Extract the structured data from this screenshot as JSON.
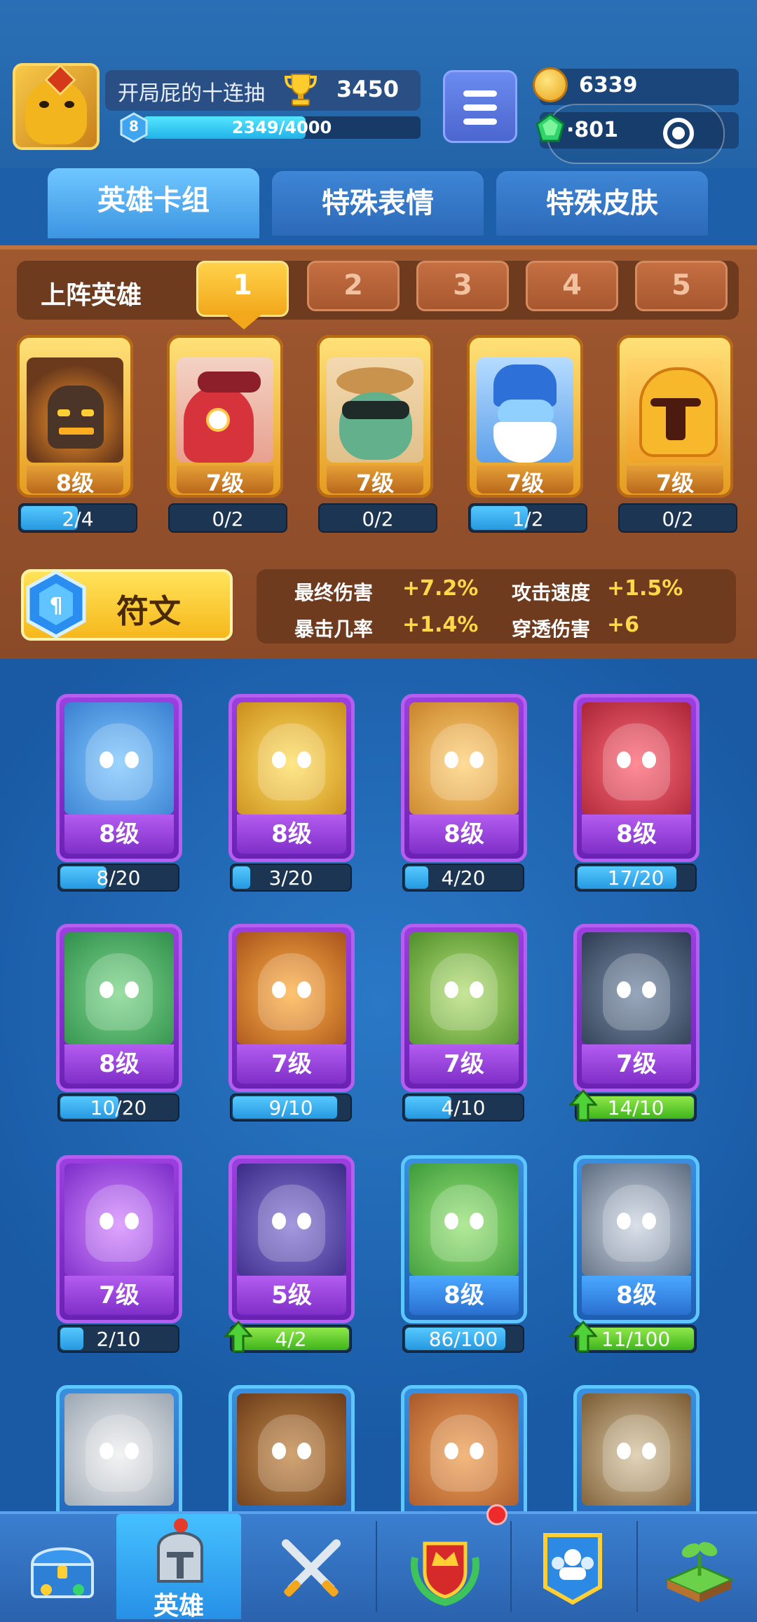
{
  "player": {
    "name": "开局屁的十连抽",
    "trophies": "3450",
    "level": "8",
    "xp_text": "2349/4000",
    "xp_fraction": 0.587
  },
  "resources": {
    "coins": "6339",
    "gems": "·801"
  },
  "tabs": [
    {
      "label": "英雄卡组",
      "active": true
    },
    {
      "label": "特殊表情",
      "active": false
    },
    {
      "label": "特殊皮肤",
      "active": false
    }
  ],
  "lineup": {
    "label": "上阵英雄",
    "slots": [
      "1",
      "2",
      "3",
      "4",
      "5"
    ],
    "active_slot": "1",
    "heroes": [
      {
        "level": "8级",
        "progress": "2/4",
        "fraction": 0.5
      },
      {
        "level": "7级",
        "progress": "0/2",
        "fraction": 0
      },
      {
        "level": "7级",
        "progress": "0/2",
        "fraction": 0
      },
      {
        "level": "7级",
        "progress": "1/2",
        "fraction": 0.5
      },
      {
        "level": "7级",
        "progress": "0/2",
        "fraction": 0
      }
    ]
  },
  "rune": {
    "label": "符文",
    "stats": [
      {
        "name": "最终伤害",
        "value": "+7.2%"
      },
      {
        "name": "攻击速度",
        "value": "+1.5%"
      },
      {
        "name": "暴击几率",
        "value": "+1.4%"
      },
      {
        "name": "穿透伤害",
        "value": "+6"
      }
    ]
  },
  "collection": [
    {
      "level": "8级",
      "progress": "8/20",
      "fraction": 0.4,
      "upgradable": false,
      "rarity": "purple"
    },
    {
      "level": "8级",
      "progress": "3/20",
      "fraction": 0.15,
      "upgradable": false,
      "rarity": "purple"
    },
    {
      "level": "8级",
      "progress": "4/20",
      "fraction": 0.2,
      "upgradable": false,
      "rarity": "purple"
    },
    {
      "level": "8级",
      "progress": "17/20",
      "fraction": 0.85,
      "upgradable": false,
      "rarity": "purple"
    },
    {
      "level": "8级",
      "progress": "10/20",
      "fraction": 0.5,
      "upgradable": false,
      "rarity": "purple"
    },
    {
      "level": "7级",
      "progress": "9/10",
      "fraction": 0.9,
      "upgradable": false,
      "rarity": "purple"
    },
    {
      "level": "7级",
      "progress": "4/10",
      "fraction": 0.4,
      "upgradable": false,
      "rarity": "purple"
    },
    {
      "level": "7级",
      "progress": "14/10",
      "fraction": 1,
      "upgradable": true,
      "rarity": "purple"
    },
    {
      "level": "7级",
      "progress": "2/10",
      "fraction": 0.2,
      "upgradable": false,
      "rarity": "purple"
    },
    {
      "level": "5级",
      "progress": "4/2",
      "fraction": 1,
      "upgradable": true,
      "rarity": "purple"
    },
    {
      "level": "8级",
      "progress": "86/100",
      "fraction": 0.86,
      "upgradable": false,
      "rarity": "blue"
    },
    {
      "level": "8级",
      "progress": "11/100",
      "fraction": 1,
      "upgradable": true,
      "rarity": "blue"
    },
    {
      "level": "",
      "progress": "",
      "fraction": 0,
      "upgradable": false,
      "rarity": "blue"
    },
    {
      "level": "",
      "progress": "",
      "fraction": 0,
      "upgradable": false,
      "rarity": "blue"
    },
    {
      "level": "",
      "progress": "",
      "fraction": 0,
      "upgradable": false,
      "rarity": "blue"
    },
    {
      "level": "",
      "progress": "",
      "fraction": 0,
      "upgradable": false,
      "rarity": "blue"
    }
  ],
  "nav": [
    {
      "icon": "treasure-chest-icon",
      "label": ""
    },
    {
      "icon": "knight-helmet-icon",
      "label": "英雄",
      "active": true
    },
    {
      "icon": "crossed-swords-icon",
      "label": ""
    },
    {
      "icon": "crown-shield-icon",
      "label": "",
      "badge": true
    },
    {
      "icon": "clan-banner-icon",
      "label": ""
    },
    {
      "icon": "sprout-island-icon",
      "label": ""
    }
  ],
  "colors": {
    "accent_gold": "#f6b81c",
    "purple_card": "#9c3fe0",
    "blue_card": "#3a8fe0",
    "progress_blue": "#2698e0",
    "progress_green": "#3fb51c",
    "stat_value": "#ffd84a"
  }
}
